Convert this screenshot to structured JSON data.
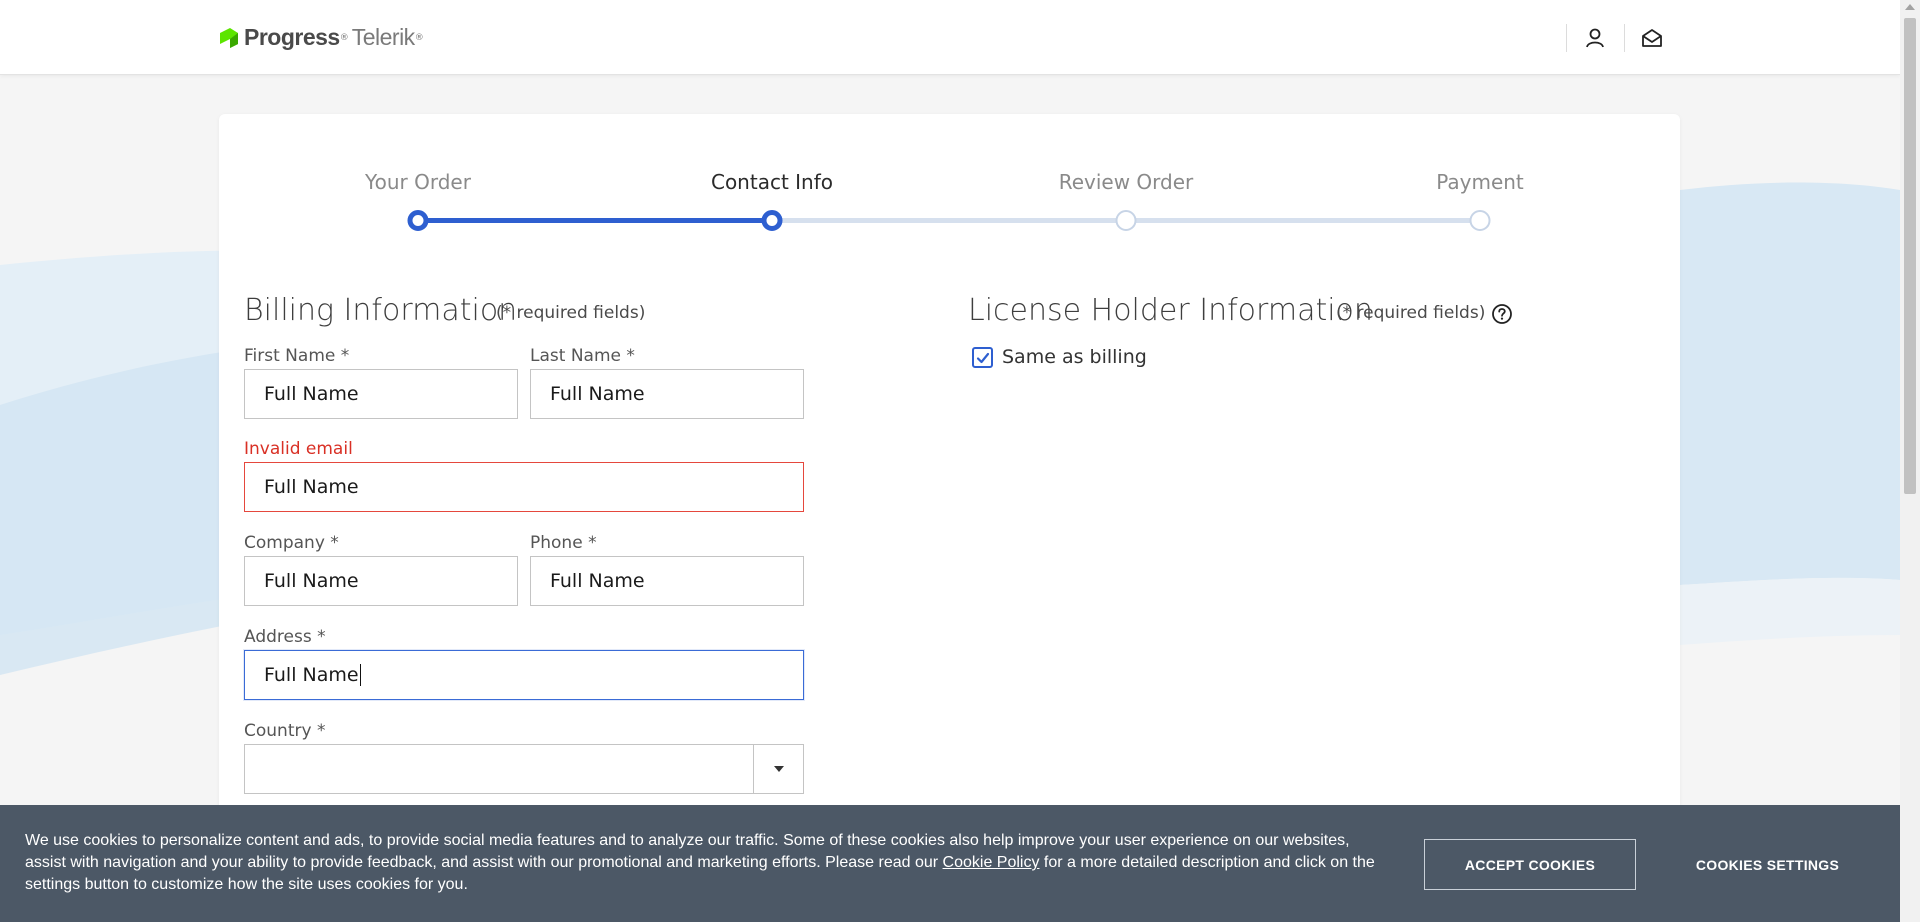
{
  "header": {
    "logo_brand": "Progress",
    "logo_product": "Telerik",
    "icons": [
      "user-icon",
      "mail-icon"
    ]
  },
  "stepper": {
    "steps": [
      {
        "label": "Your Order",
        "state": "completed"
      },
      {
        "label": "Contact Info",
        "state": "active"
      },
      {
        "label": "Review Order",
        "state": "pending"
      },
      {
        "label": "Payment",
        "state": "pending"
      }
    ]
  },
  "billing": {
    "title": "Billing Information",
    "required_note": "(* required fields)",
    "first_name": {
      "label": "First Name *",
      "value": "Full Name"
    },
    "last_name": {
      "label": "Last Name *",
      "value": "Full Name"
    },
    "email": {
      "label": "Invalid email",
      "value": "Full Name",
      "state": "error"
    },
    "company": {
      "label": "Company *",
      "value": "Full Name"
    },
    "phone": {
      "label": "Phone *",
      "value": "Full Name"
    },
    "address": {
      "label": "Address *",
      "value": "Full Name",
      "state": "focused"
    },
    "country": {
      "label": "Country *",
      "value": ""
    }
  },
  "license_holder": {
    "title": "License Holder Information",
    "required_note": "(* required fields)",
    "same_as_billing": {
      "label": "Same as billing",
      "checked": true
    }
  },
  "cookie_banner": {
    "text_before_link": "We use cookies to personalize content and ads, to provide social media features and to analyze our traffic. Some of these cookies also help improve your user experience on our websites, assist with navigation and your ability to provide feedback, and assist with our promotional and marketing efforts. Please read our ",
    "link_text": "Cookie Policy",
    "text_after_link": " for a more detailed description and click on the settings button to customize how the site uses cookies for you.",
    "accept_label": "ACCEPT COOKIES",
    "settings_label": "COOKIES SETTINGS"
  },
  "colors": {
    "accent": "#2e5fd0",
    "error": "#d93025",
    "banner_bg": "#4c5866",
    "logo_green": "#5ce500"
  }
}
